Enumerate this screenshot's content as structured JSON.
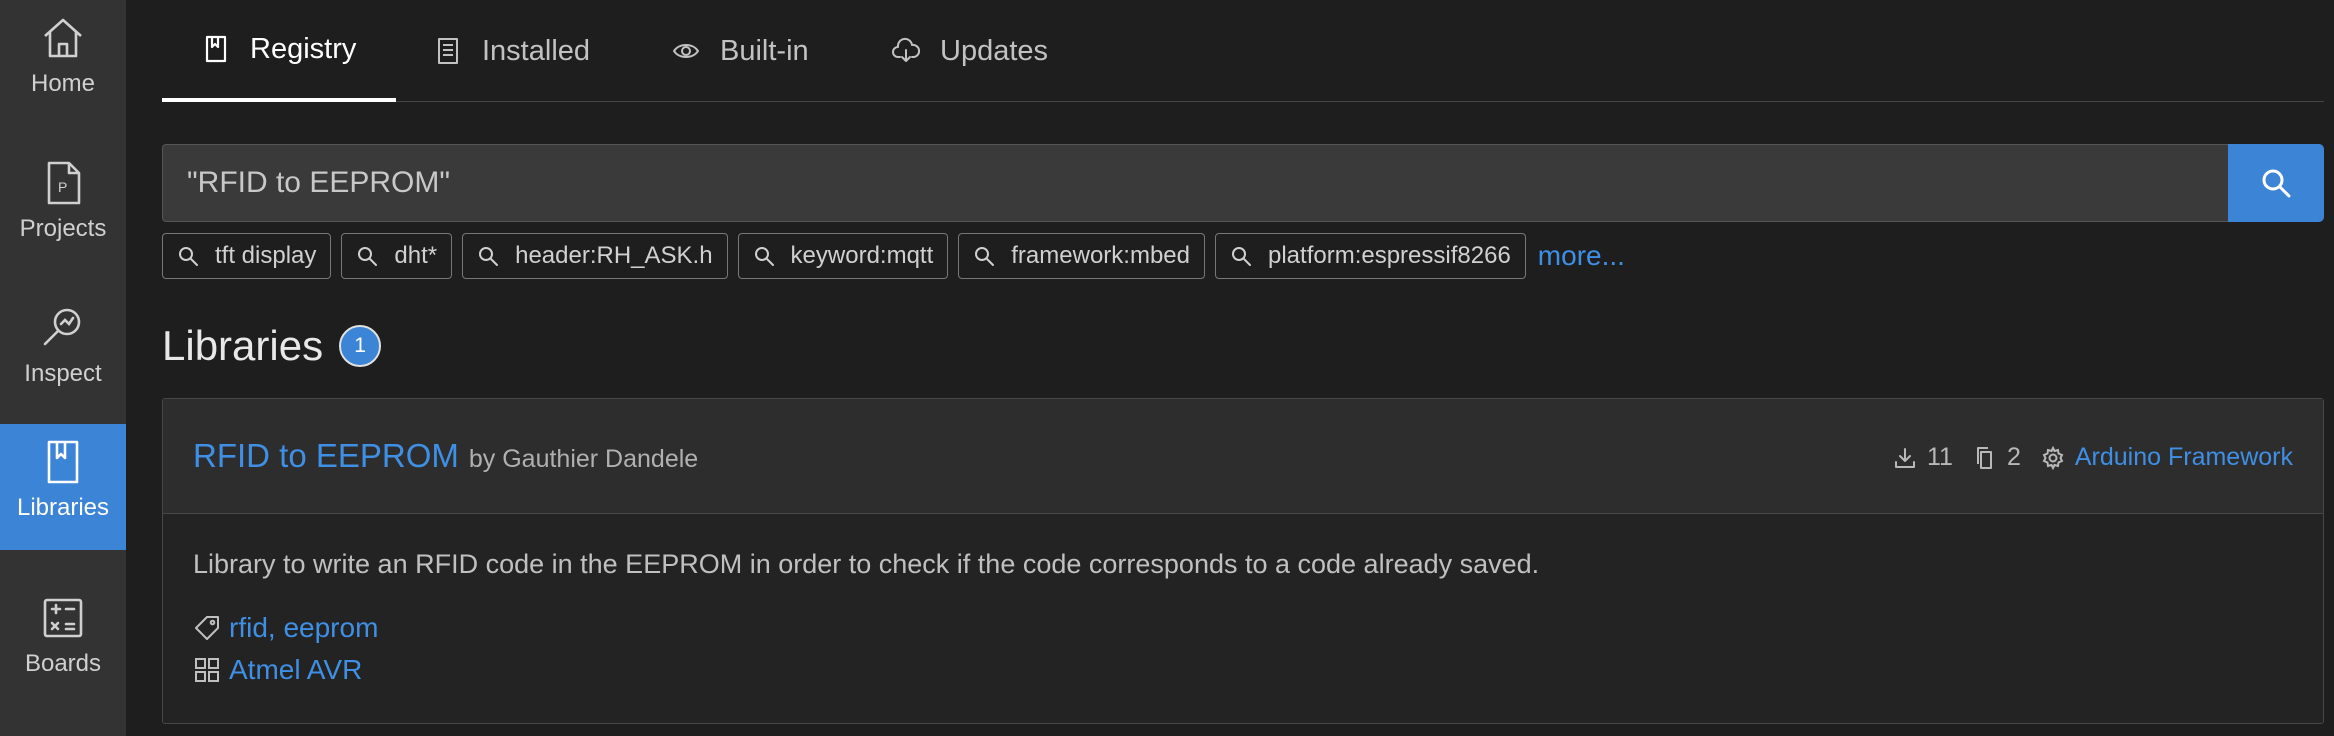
{
  "sidebar": {
    "items": [
      {
        "label": "Home",
        "icon": "home-icon"
      },
      {
        "label": "Projects",
        "icon": "projects-icon"
      },
      {
        "label": "Inspect",
        "icon": "inspect-icon"
      },
      {
        "label": "Libraries",
        "icon": "libraries-icon",
        "active": true
      },
      {
        "label": "Boards",
        "icon": "boards-icon"
      }
    ]
  },
  "tabs": [
    {
      "label": "Registry",
      "icon": "bookmark-icon",
      "active": true
    },
    {
      "label": "Installed",
      "icon": "list-icon"
    },
    {
      "label": "Built-in",
      "icon": "eye-icon"
    },
    {
      "label": "Updates",
      "icon": "cloud-download-icon"
    }
  ],
  "search": {
    "value": "\"RFID to EEPROM\"",
    "button_icon": "search-icon"
  },
  "chips": [
    "tft display",
    "dht*",
    "header:RH_ASK.h",
    "keyword:mqtt",
    "framework:mbed",
    "platform:espressif8266"
  ],
  "more_label": "more...",
  "libraries": {
    "title": "Libraries",
    "count": "1"
  },
  "result": {
    "name": "RFID to EEPROM",
    "author": "by Gauthier Dandele",
    "downloads": "11",
    "examples": "2",
    "framework": "Arduino Framework",
    "description": "Library to write an RFID code in the EEPROM in order to check if the code corresponds to a code already saved.",
    "keywords": "rfid, eeprom",
    "platform": "Atmel AVR"
  },
  "colors": {
    "accent": "#3c84d6",
    "link": "#3f8fe5",
    "background": "#1e1e1e",
    "sidebar": "#333333"
  }
}
